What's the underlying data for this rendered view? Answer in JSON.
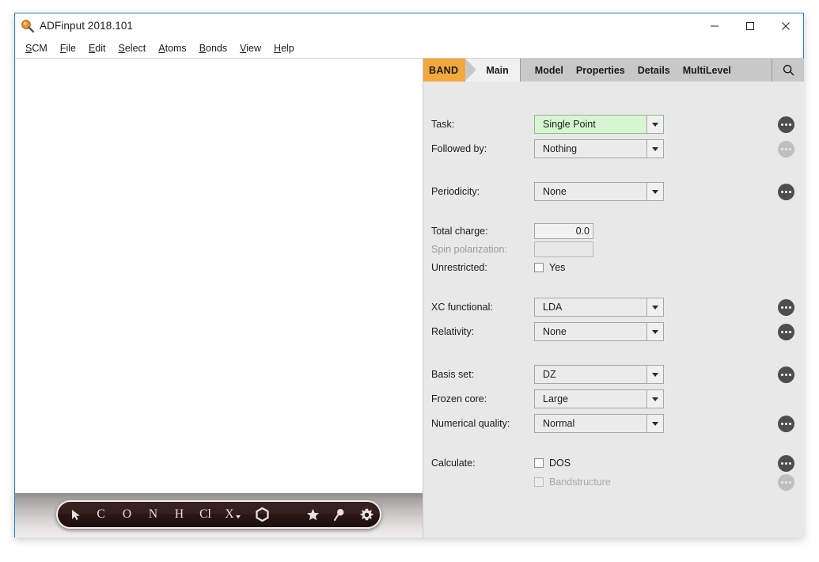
{
  "window": {
    "title": "ADFinput 2018.101",
    "icon": "magnifier-icon",
    "minimize": "–",
    "maximize": "□",
    "close": "✕"
  },
  "menu": {
    "items": [
      {
        "label": "SCM",
        "accel": "S"
      },
      {
        "label": "File",
        "accel": "F"
      },
      {
        "label": "Edit",
        "accel": "E"
      },
      {
        "label": "Select",
        "accel": "S"
      },
      {
        "label": "Atoms",
        "accel": "A"
      },
      {
        "label": "Bonds",
        "accel": "B"
      },
      {
        "label": "View",
        "accel": "V"
      },
      {
        "label": "Help",
        "accel": "H"
      }
    ]
  },
  "tabs": {
    "module": "BAND",
    "active": "Main",
    "others": [
      "Model",
      "Properties",
      "Details",
      "MultiLevel"
    ],
    "search_icon": "search-icon"
  },
  "molecule_toolbar": {
    "cursor": "➤",
    "elements": [
      "C",
      "O",
      "N",
      "H",
      "Cl"
    ],
    "custom_element": "X",
    "ring": "⬡",
    "star": "★",
    "magnifier": "⚲",
    "gear": "⚙"
  },
  "form": {
    "task": {
      "label": "Task:",
      "value": "Single Point",
      "highlighted": true
    },
    "followed_by": {
      "label": "Followed by:",
      "value": "Nothing"
    },
    "periodicity": {
      "label": "Periodicity:",
      "value": "None"
    },
    "total_charge": {
      "label": "Total charge:",
      "value": "0.0"
    },
    "spin_polarization": {
      "label": "Spin polarization:",
      "value": ""
    },
    "unrestricted": {
      "label": "Unrestricted:",
      "checkbox_label": "Yes",
      "checked": false
    },
    "xc_functional": {
      "label": "XC functional:",
      "value": "LDA"
    },
    "relativity": {
      "label": "Relativity:",
      "value": "None"
    },
    "basis_set": {
      "label": "Basis set:",
      "value": "DZ"
    },
    "frozen_core": {
      "label": "Frozen core:",
      "value": "Large"
    },
    "numerical_quality": {
      "label": "Numerical quality:",
      "value": "Normal"
    },
    "calculate": {
      "label": "Calculate:"
    },
    "dos": {
      "checkbox_label": "DOS",
      "checked": false
    },
    "bandstructure": {
      "checkbox_label": "Bandstructure",
      "checked": false
    }
  },
  "colors": {
    "accent_orange": "#f2a93b",
    "highlight_green": "#d7f5d2",
    "panel_gray": "#e8e8e8",
    "window_border": "#2a7fd4"
  }
}
